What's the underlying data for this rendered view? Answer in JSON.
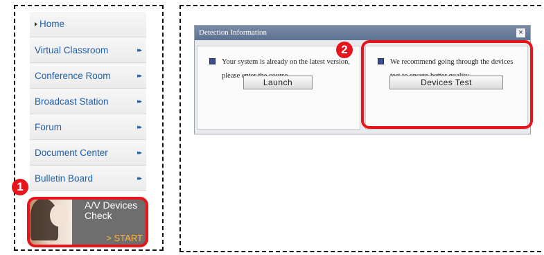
{
  "menu": {
    "items": [
      {
        "label": "Home",
        "arrow": ""
      },
      {
        "label": "Virtual Classroom",
        "arrow": "▸▸"
      },
      {
        "label": "Conference Room",
        "arrow": "▸▸"
      },
      {
        "label": "Broadcast Station",
        "arrow": "▸▸"
      },
      {
        "label": "Forum",
        "arrow": "▸▸"
      },
      {
        "label": "Document Center",
        "arrow": "▸▸"
      },
      {
        "label": "Bulletin Board",
        "arrow": "▸▸"
      }
    ]
  },
  "check_card": {
    "line1": "A/V Devices",
    "line2": "Check",
    "start": "> START"
  },
  "badges": {
    "one": "1",
    "two": "2"
  },
  "dialog": {
    "title": "Detection Information",
    "close": "×",
    "left_message": "Your system is already on the latest version, please enter the course.",
    "right_message": "We recommend going through the devices test to ensure better quality.",
    "launch_label": "Launch",
    "devices_label": "Devices Test"
  },
  "colors": {
    "highlight": "#e8141c",
    "link": "#1f5fa8",
    "title_bar": "#6a7e9c",
    "start": "#ffb33a"
  }
}
